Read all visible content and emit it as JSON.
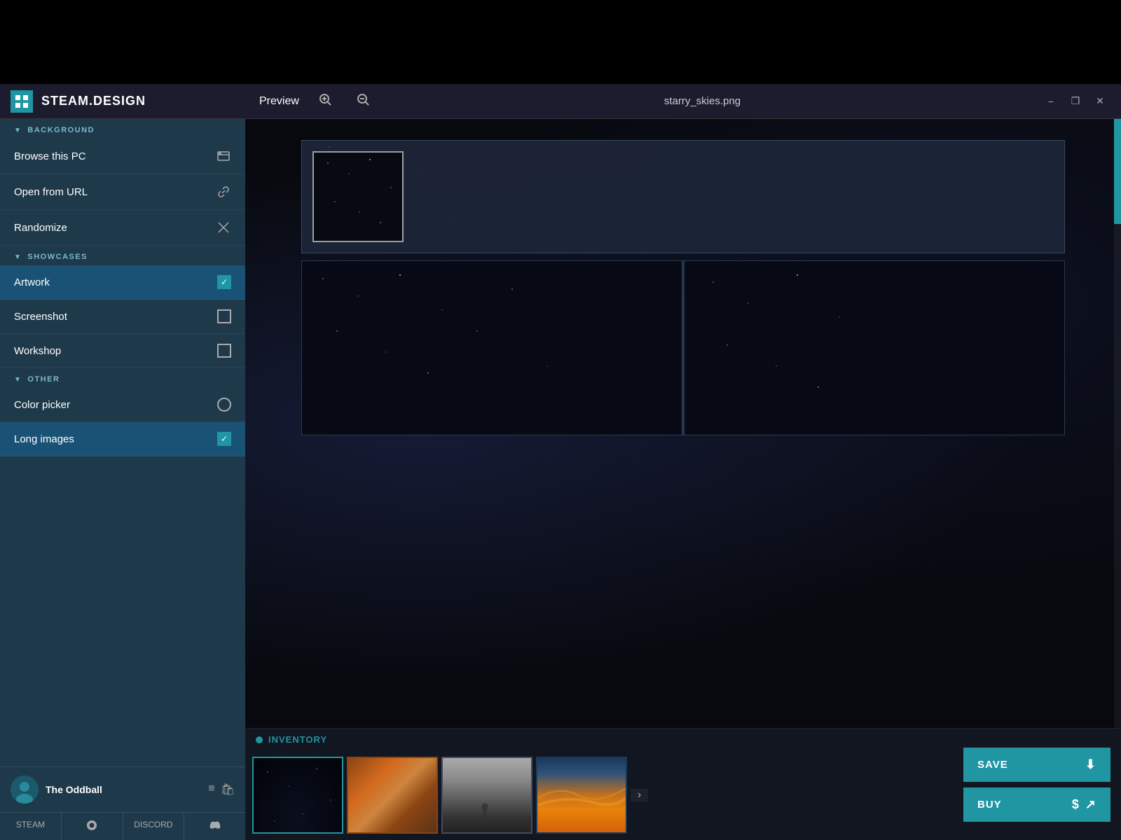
{
  "app": {
    "title": "STEAM.DESIGN",
    "filename": "starry_skies.png"
  },
  "titlebar": {
    "preview_label": "Preview",
    "zoom_in": "+",
    "zoom_out": "−",
    "minimize": "−",
    "maximize": "❐",
    "close": "✕"
  },
  "sidebar": {
    "background_section": "BACKGROUND",
    "showcases_section": "SHOWCASES",
    "other_section": "OTHER",
    "items": {
      "browse": "Browse this PC",
      "open_url": "Open from URL",
      "randomize": "Randomize",
      "artwork": "Artwork",
      "screenshot": "Screenshot",
      "workshop": "Workshop",
      "color_picker": "Color picker",
      "long_images": "Long images"
    }
  },
  "user": {
    "name": "The Oddball",
    "steam_label": "STEAM",
    "discord_label": "DISCORD"
  },
  "inventory": {
    "label": "INVENTORY"
  },
  "buttons": {
    "save": "SAVE",
    "buy": "BUY"
  },
  "icons": {
    "browse": "🖼",
    "link": "🔗",
    "random": "✕",
    "settings": "≡",
    "store": "🛍",
    "download": "⬇",
    "dollar": "$",
    "share": "↗",
    "more": "›"
  }
}
